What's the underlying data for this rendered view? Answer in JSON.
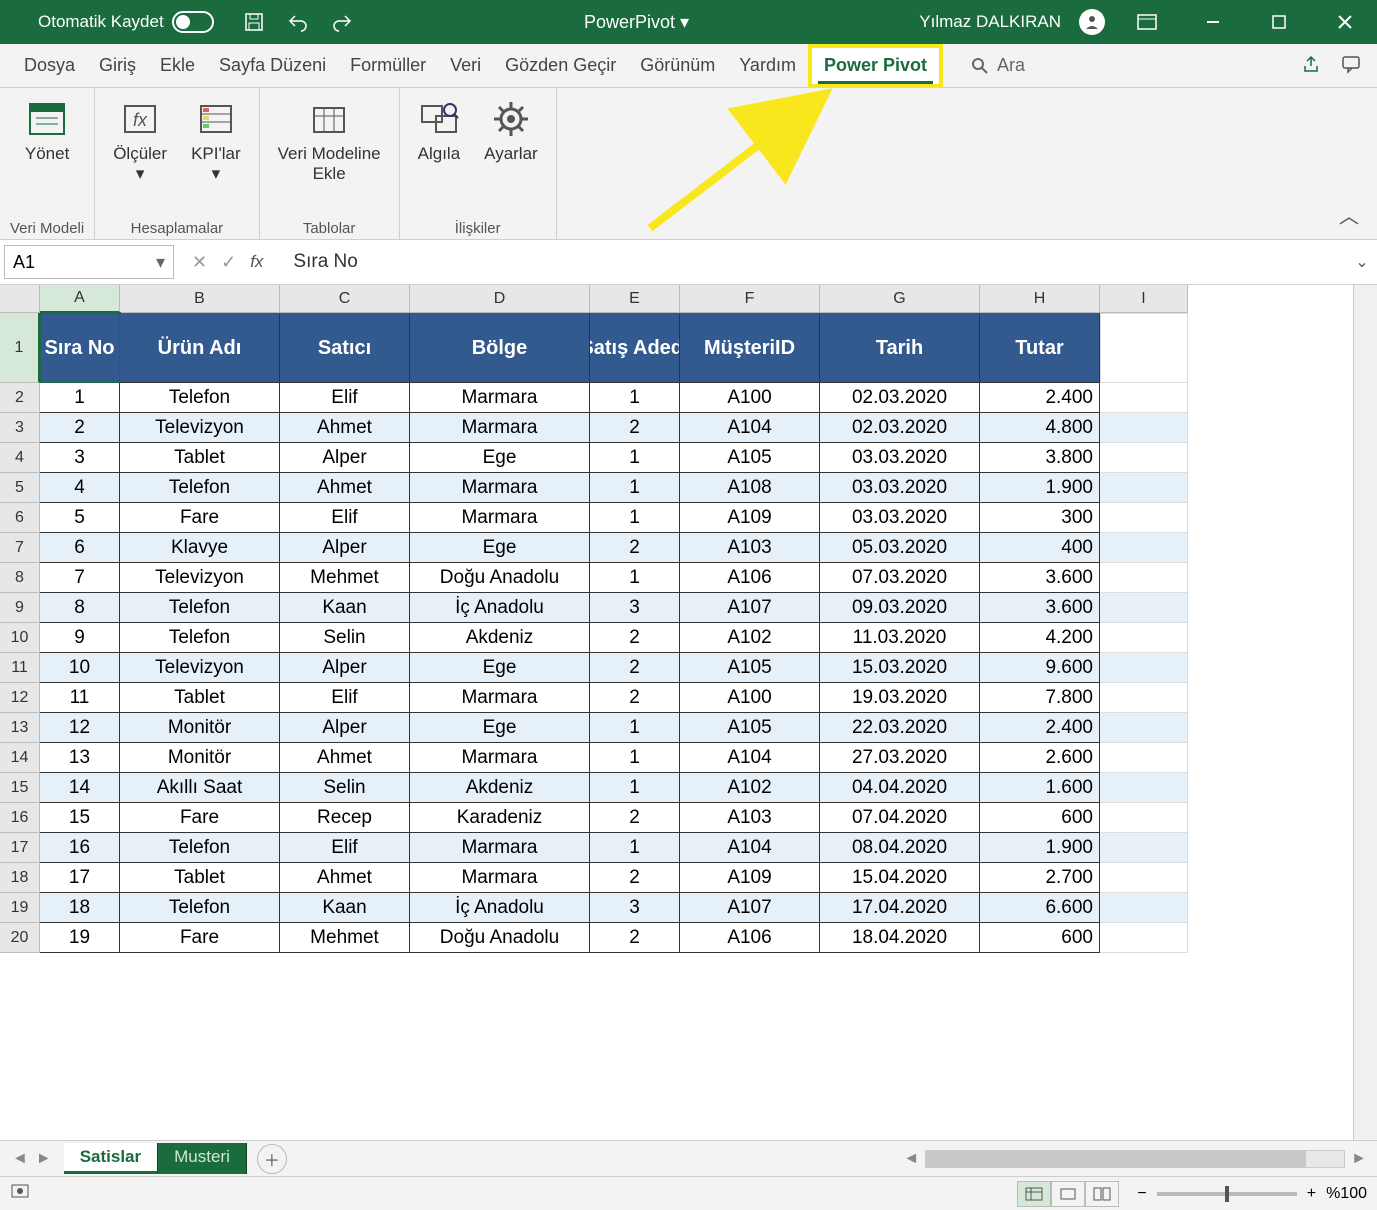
{
  "titlebar": {
    "autosave_label": "Otomatik Kaydet",
    "doc_title": "PowerPivot ▾",
    "username": "Yılmaz DALKIRAN"
  },
  "tabs": {
    "items": [
      "Dosya",
      "Giriş",
      "Ekle",
      "Sayfa Düzeni",
      "Formüller",
      "Veri",
      "Gözden Geçir",
      "Görünüm",
      "Yardım",
      "Power Pivot"
    ],
    "active_index": 9,
    "search_label": "Ara"
  },
  "ribbon": {
    "groups": [
      {
        "label": "Veri Modeli",
        "buttons": [
          {
            "label": "Yönet"
          }
        ]
      },
      {
        "label": "Hesaplamalar",
        "buttons": [
          {
            "label": "Ölçüler\n▾"
          },
          {
            "label": "KPI'lar\n▾"
          }
        ]
      },
      {
        "label": "Tablolar",
        "buttons": [
          {
            "label": "Veri Modeline\nEkle"
          }
        ]
      },
      {
        "label": "İlişkiler",
        "buttons": [
          {
            "label": "Algıla"
          },
          {
            "label": "Ayarlar"
          }
        ]
      }
    ]
  },
  "formula": {
    "name_box": "A1",
    "value": "Sıra No"
  },
  "grid": {
    "columns": [
      "A",
      "B",
      "C",
      "D",
      "E",
      "F",
      "G",
      "H",
      "I"
    ],
    "col_classes": [
      "cA",
      "cB",
      "cC",
      "cD",
      "cE",
      "cF",
      "cG",
      "cH",
      "cI"
    ],
    "selected_cell": "A1",
    "headers": [
      "Sıra No",
      "Ürün Adı",
      "Satıcı",
      "Bölge",
      "Satış Adedi",
      "MüşteriID",
      "Tarih",
      "Tutar"
    ],
    "rows": [
      [
        "1",
        "Telefon",
        "Elif",
        "Marmara",
        "1",
        "A100",
        "02.03.2020",
        "2.400"
      ],
      [
        "2",
        "Televizyon",
        "Ahmet",
        "Marmara",
        "2",
        "A104",
        "02.03.2020",
        "4.800"
      ],
      [
        "3",
        "Tablet",
        "Alper",
        "Ege",
        "1",
        "A105",
        "03.03.2020",
        "3.800"
      ],
      [
        "4",
        "Telefon",
        "Ahmet",
        "Marmara",
        "1",
        "A108",
        "03.03.2020",
        "1.900"
      ],
      [
        "5",
        "Fare",
        "Elif",
        "Marmara",
        "1",
        "A109",
        "03.03.2020",
        "300"
      ],
      [
        "6",
        "Klavye",
        "Alper",
        "Ege",
        "2",
        "A103",
        "05.03.2020",
        "400"
      ],
      [
        "7",
        "Televizyon",
        "Mehmet",
        "Doğu Anadolu",
        "1",
        "A106",
        "07.03.2020",
        "3.600"
      ],
      [
        "8",
        "Telefon",
        "Kaan",
        "İç Anadolu",
        "3",
        "A107",
        "09.03.2020",
        "3.600"
      ],
      [
        "9",
        "Telefon",
        "Selin",
        "Akdeniz",
        "2",
        "A102",
        "11.03.2020",
        "4.200"
      ],
      [
        "10",
        "Televizyon",
        "Alper",
        "Ege",
        "2",
        "A105",
        "15.03.2020",
        "9.600"
      ],
      [
        "11",
        "Tablet",
        "Elif",
        "Marmara",
        "2",
        "A100",
        "19.03.2020",
        "7.800"
      ],
      [
        "12",
        "Monitör",
        "Alper",
        "Ege",
        "1",
        "A105",
        "22.03.2020",
        "2.400"
      ],
      [
        "13",
        "Monitör",
        "Ahmet",
        "Marmara",
        "1",
        "A104",
        "27.03.2020",
        "2.600"
      ],
      [
        "14",
        "Akıllı Saat",
        "Selin",
        "Akdeniz",
        "1",
        "A102",
        "04.04.2020",
        "1.600"
      ],
      [
        "15",
        "Fare",
        "Recep",
        "Karadeniz",
        "2",
        "A103",
        "07.04.2020",
        "600"
      ],
      [
        "16",
        "Telefon",
        "Elif",
        "Marmara",
        "1",
        "A104",
        "08.04.2020",
        "1.900"
      ],
      [
        "17",
        "Tablet",
        "Ahmet",
        "Marmara",
        "2",
        "A109",
        "15.04.2020",
        "2.700"
      ],
      [
        "18",
        "Telefon",
        "Kaan",
        "İç Anadolu",
        "3",
        "A107",
        "17.04.2020",
        "6.600"
      ],
      [
        "19",
        "Fare",
        "Mehmet",
        "Doğu Anadolu",
        "2",
        "A106",
        "18.04.2020",
        "600"
      ]
    ]
  },
  "sheets": {
    "tabs": [
      "Satislar",
      "Musteri"
    ],
    "active_index": 0
  },
  "status": {
    "zoom": "%100"
  }
}
